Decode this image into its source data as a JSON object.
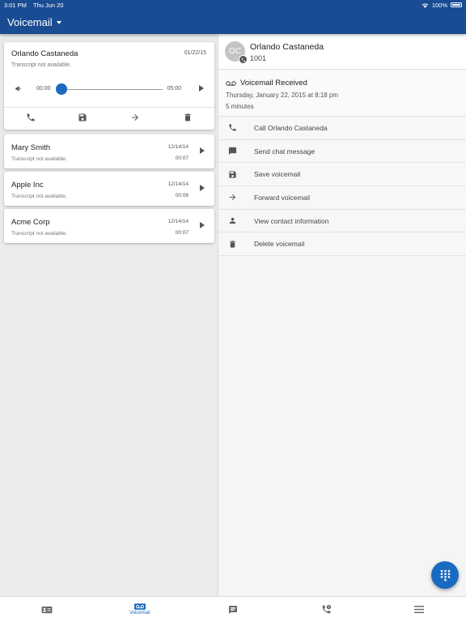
{
  "status": {
    "time": "3:01 PM",
    "date": "Thu Jun 20",
    "battery": "100%"
  },
  "header": {
    "title": "Voicemail"
  },
  "voicemails": [
    {
      "name": "Orlando Castaneda",
      "date": "01/22/15",
      "transcript": "Transcript not available.",
      "player": {
        "elapsed": "00:00",
        "total": "05:00",
        "progress": 0
      }
    },
    {
      "name": "Mary Smith",
      "date": "12/14/14",
      "duration": "00:07",
      "transcript": "Transcript not available."
    },
    {
      "name": "Apple Inc",
      "date": "12/14/14",
      "duration": "00:08",
      "transcript": "Transcript not available."
    },
    {
      "name": "Acme Corp",
      "date": "12/14/14",
      "duration": "00:07",
      "transcript": "Transcript not available."
    }
  ],
  "detail": {
    "initials": "OC",
    "name": "Orlando Castaneda",
    "extension": "1001",
    "status": "Voicemail Received",
    "received": "Thursday, January 22, 2015 at 8:18 pm",
    "duration": "5 minutes",
    "actions": [
      {
        "label": "Call Orlando Castaneda",
        "icon": "phone-icon"
      },
      {
        "label": "Send chat message",
        "icon": "chat-icon"
      },
      {
        "label": "Save voicemail",
        "icon": "save-icon"
      },
      {
        "label": "Forward voicemail",
        "icon": "forward-arrow-icon"
      },
      {
        "label": "View contact information",
        "icon": "person-icon"
      },
      {
        "label": "Delete voicemail",
        "icon": "trash-icon"
      }
    ]
  },
  "nav": [
    {
      "icon": "contacts-card-icon",
      "label": ""
    },
    {
      "icon": "voicemail-icon",
      "label": "Voicemail",
      "active": true
    },
    {
      "icon": "chat-icon",
      "label": ""
    },
    {
      "icon": "call-history-icon",
      "label": ""
    },
    {
      "icon": "menu-icon",
      "label": ""
    }
  ],
  "colors": {
    "primary": "#1a4c94",
    "accent": "#1a6bc0",
    "icon": "#555555"
  }
}
